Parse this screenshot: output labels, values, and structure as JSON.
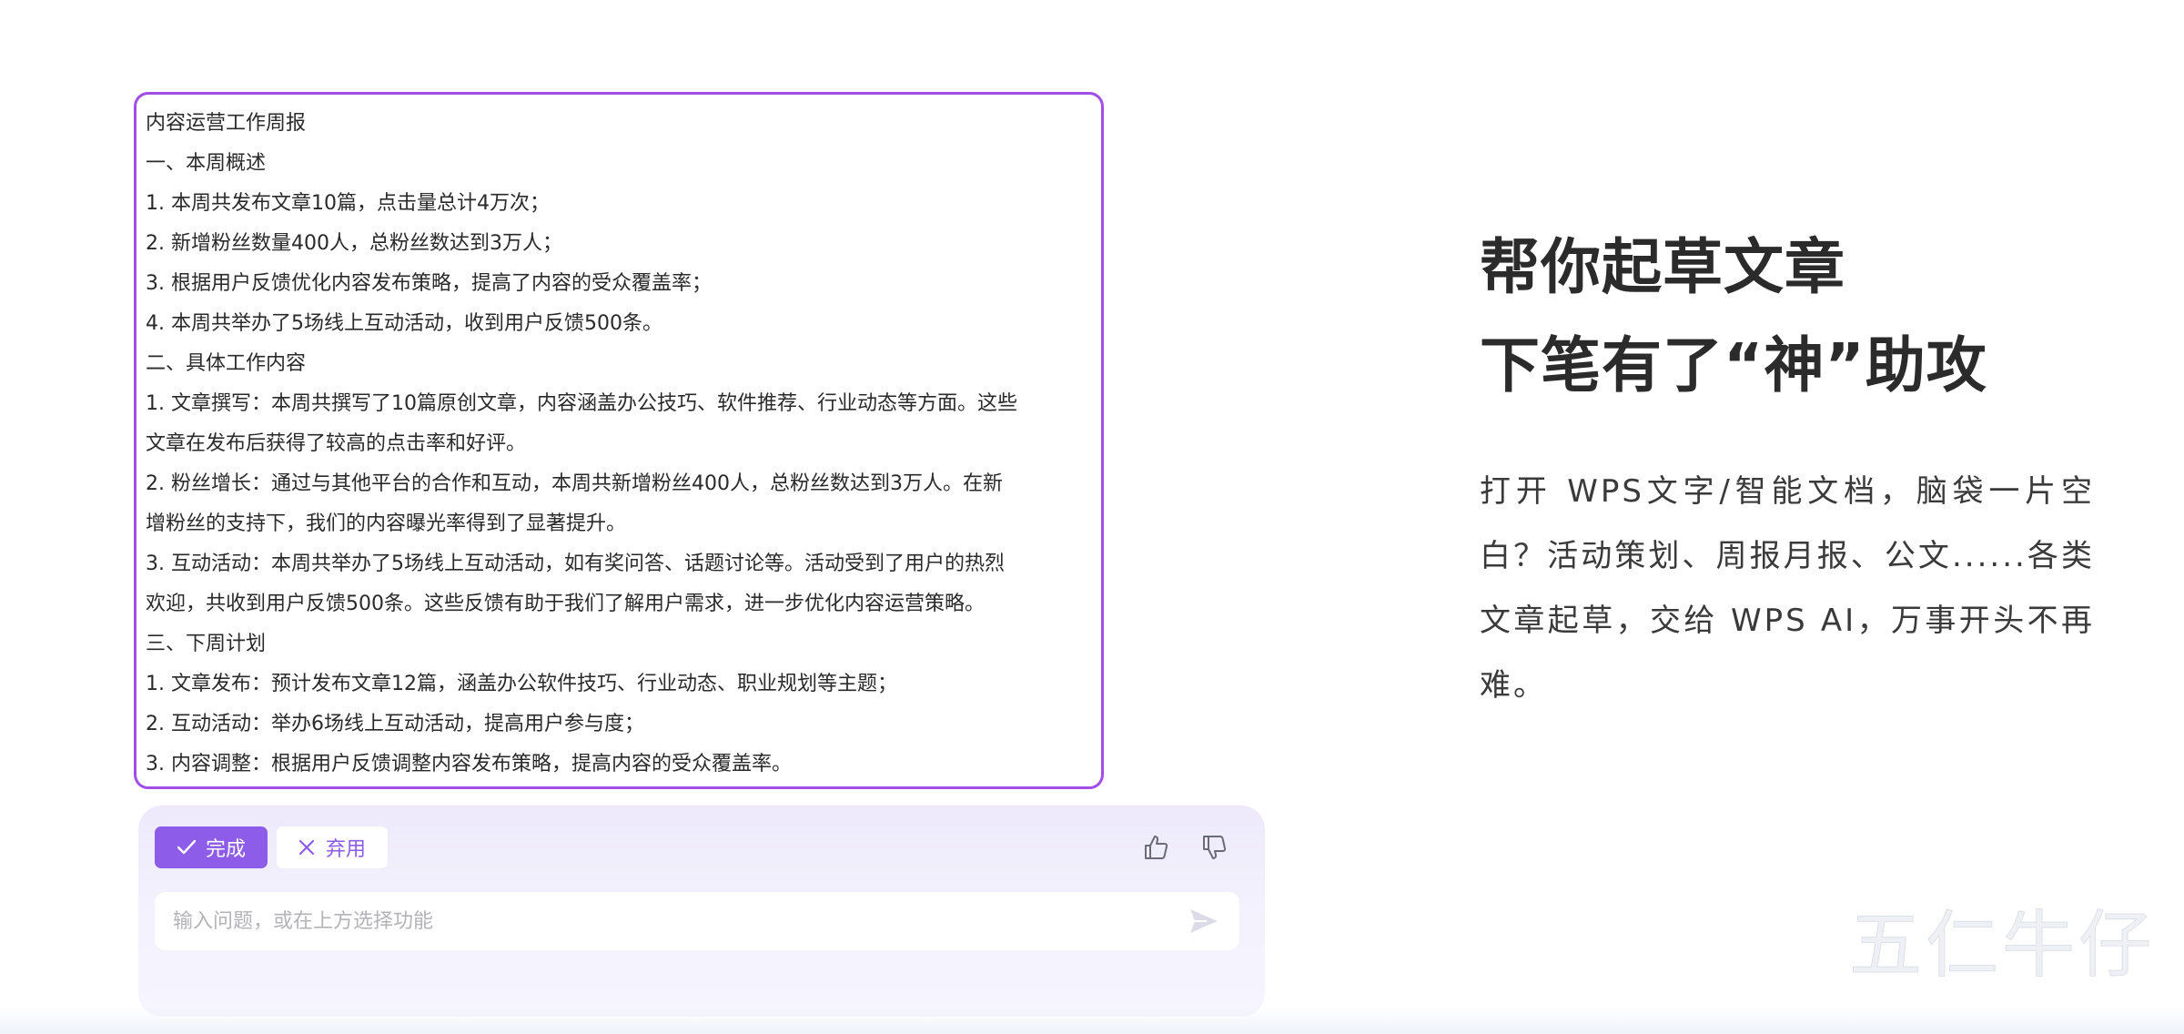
{
  "document": {
    "lines": [
      "内容运营工作周报",
      "一、本周概述",
      "1. 本周共发布文章10篇，点击量总计4万次；",
      "2. 新增粉丝数量400人，总粉丝数达到3万人；",
      "3. 根据用户反馈优化内容发布策略，提高了内容的受众覆盖率；",
      "4. 本周共举办了5场线上互动活动，收到用户反馈500条。",
      "二、具体工作内容",
      "1. 文章撰写：本周共撰写了10篇原创文章，内容涵盖办公技巧、软件推荐、行业动态等方面。这些",
      "文章在发布后获得了较高的点击率和好评。",
      "2. 粉丝增长：通过与其他平台的合作和互动，本周共新增粉丝400人，总粉丝数达到3万人。在新",
      "增粉丝的支持下，我们的内容曝光率得到了显著提升。",
      "3. 互动活动：本周共举办了5场线上互动活动，如有奖问答、话题讨论等。活动受到了用户的热烈",
      "欢迎，共收到用户反馈500条。这些反馈有助于我们了解用户需求，进一步优化内容运营策略。",
      "三、下周计划",
      "1. 文章发布：预计发布文章12篇，涵盖办公软件技巧、行业动态、职业规划等主题；",
      "2. 互动活动：举办6场线上互动活动，提高用户参与度；",
      "3. 内容调整：根据用户反馈调整内容发布策略，提高内容的受众覆盖率。"
    ]
  },
  "ai_panel": {
    "done_label": "完成",
    "discard_label": "弃用",
    "input_placeholder": "输入问题，或在上方选择功能",
    "like_icon": "thumbs-up-icon",
    "dislike_icon": "thumbs-down-icon",
    "send_icon": "send-icon"
  },
  "marketing": {
    "headline_line1": "帮你起草文章",
    "headline_line2": "下笔有了“神”助攻",
    "description": "打开 WPS文字/智能文档，脑袋一片空白？活动策划、周报月报、公文......各类文章起草，交给 WPS AI，万事开头不再难。"
  },
  "watermark": {
    "text": "五仁牛仔"
  },
  "colors": {
    "accent": "#8d5ce9",
    "doc_border": "#a14ee6",
    "panel_bg": "#f1eefc",
    "text": "#2a2a2a"
  }
}
